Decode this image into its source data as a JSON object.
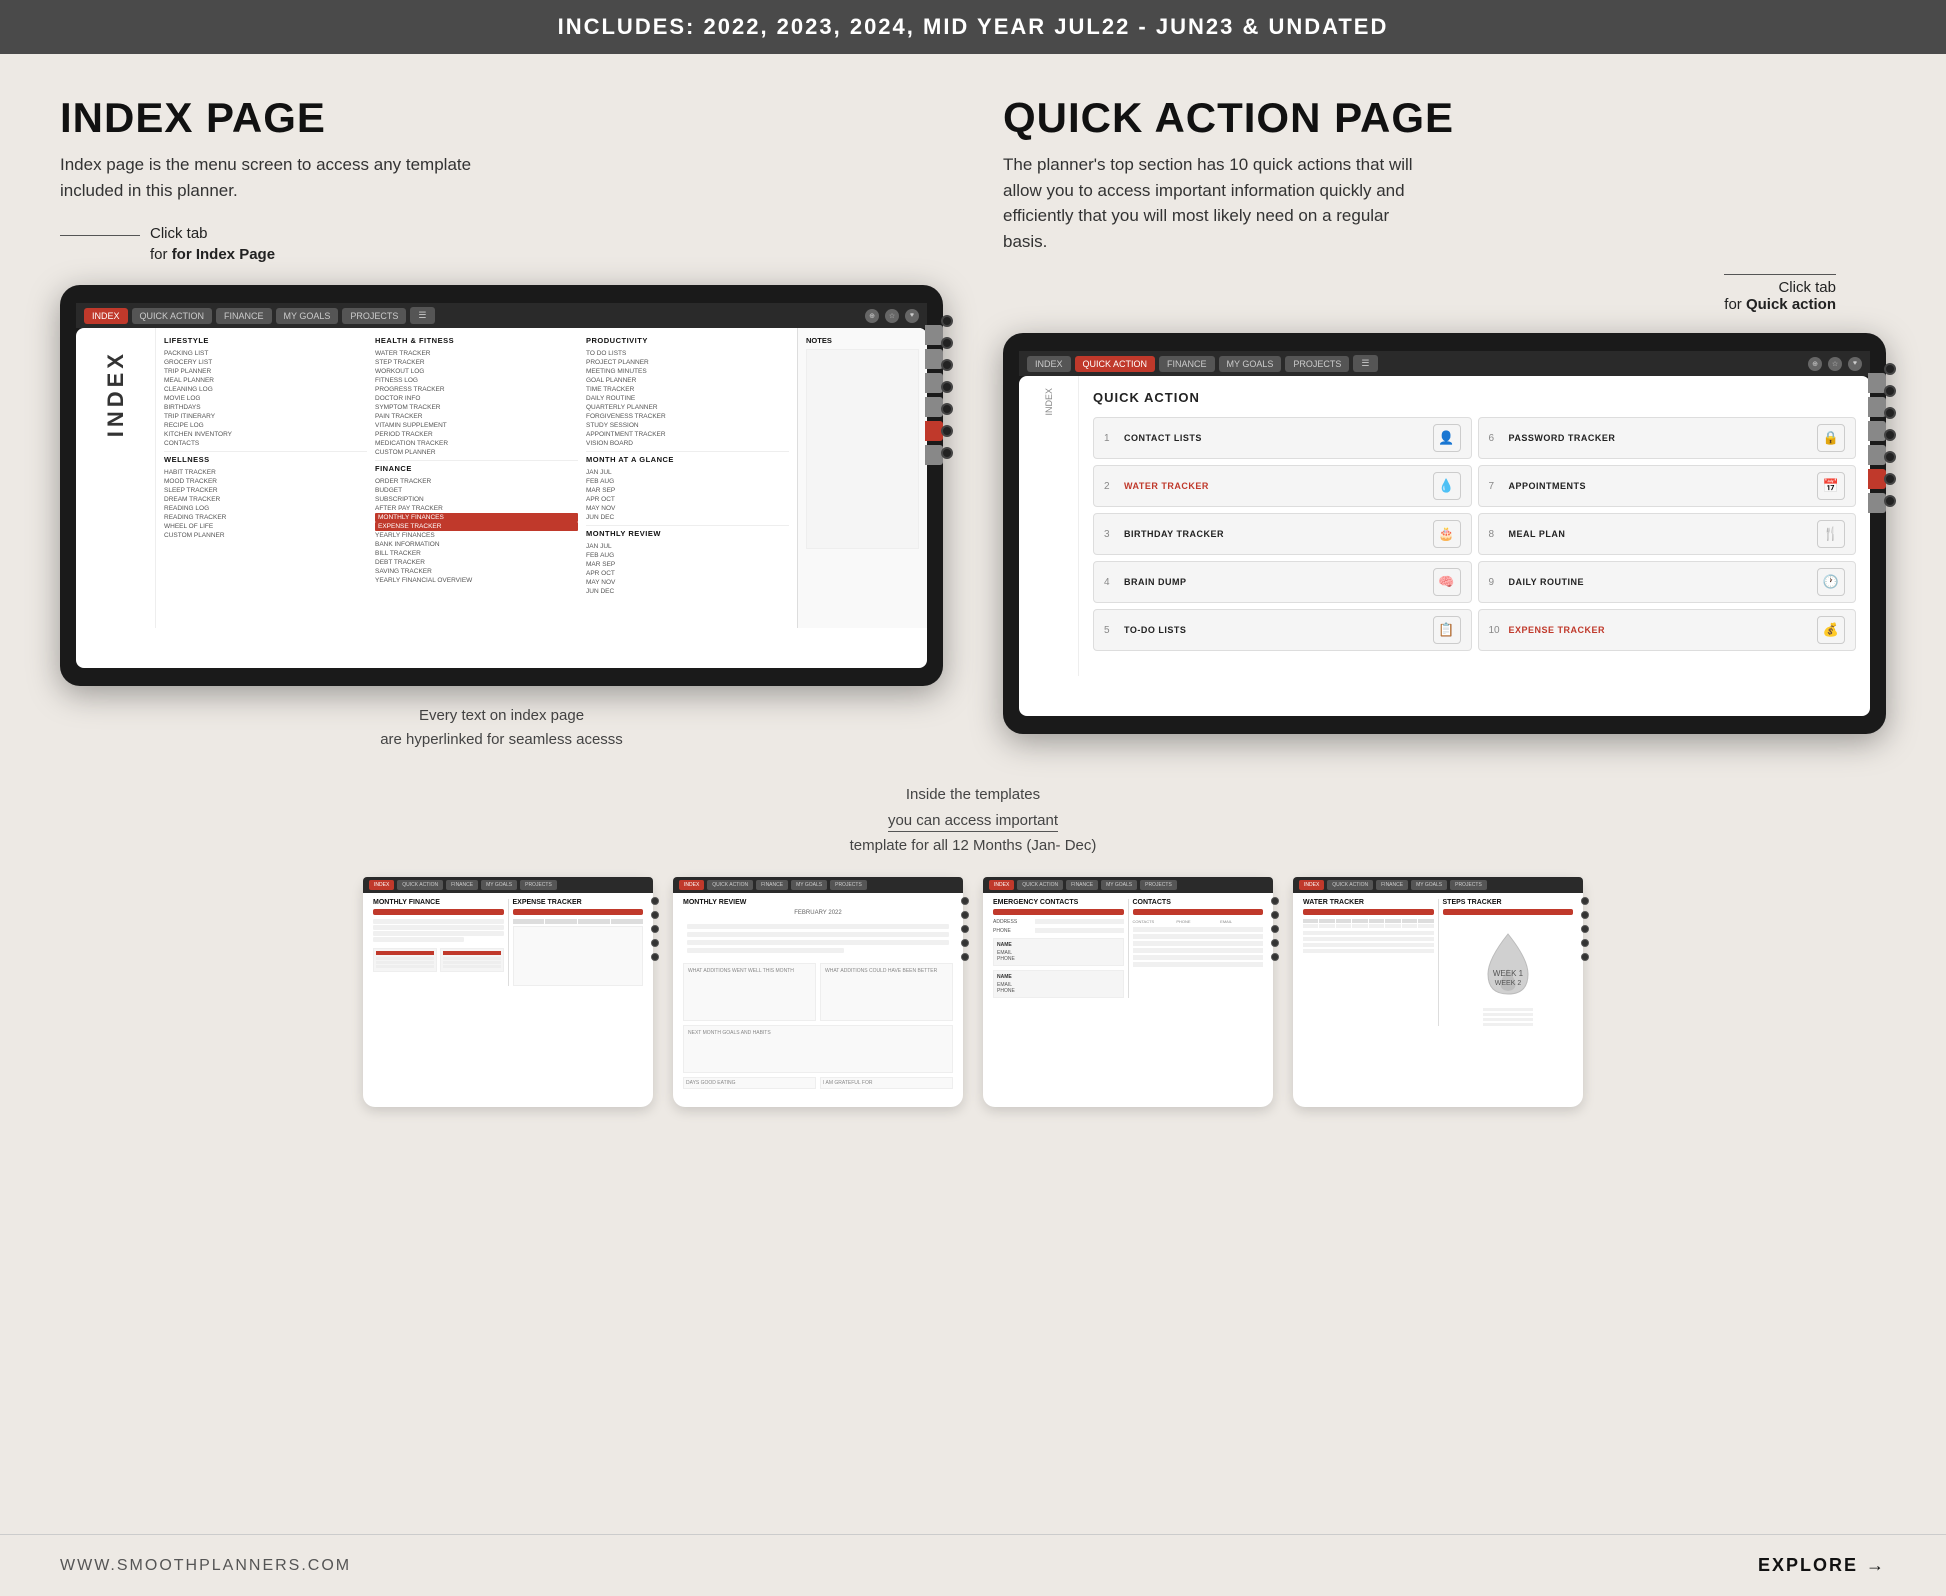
{
  "banner": {
    "text": "INCLUDES: 2022, 2023, 2024, MID YEAR JUL22 - JUN23 & UNDATED"
  },
  "left_section": {
    "title": "INDEX PAGE",
    "description": "Index page is the menu screen to access any template included in this planner.",
    "callout": {
      "line1": "Click tab",
      "line2": "for Index Page"
    },
    "tablet": {
      "nav_tabs": [
        "INDEX",
        "QUICK ACTION",
        "FINANCE",
        "MY GOALS",
        "PROJECTS"
      ],
      "active_tab": "INDEX",
      "index_heading": "INDEX",
      "lifestyle_items": [
        "LIFESTYLE",
        "PACKING LIST",
        "GROCERY LIST",
        "TRIP PLANNER",
        "MEAL PLANNER",
        "CLEANING LOG",
        "MOVIE LOG",
        "BIRTHDAYS",
        "TRIP ITINERARY",
        "RECIPE LOG",
        "KITCHEN INVENTORY",
        "CONTACTS"
      ],
      "wellness_items": [
        "WELLNESS",
        "HABIT TRACKER",
        "MOOD TRACKER",
        "SLEEP TRACKER",
        "DREAM TRACKER",
        "READING LOG",
        "READING TRACKER",
        "WHEEL OF LIFE",
        "CUSTOM PLANNER"
      ],
      "health_items": [
        "HEALTH & FITNESS",
        "WATER TRACKER",
        "STEP TRACKER",
        "WORKOUT LOG",
        "FITNESS LOG",
        "PROGRESS TRACKER",
        "DOCTOR INFO",
        "SYMPTOM TRACKER",
        "PAIN TRACKER",
        "VITAMIN SUPPLEMENT",
        "PERIOD TRACKER",
        "MEDICATION TRACKER",
        "CUSTOM PLANNER"
      ],
      "finance_items": [
        "FINANCE",
        "ORDER TRACKER",
        "BUDGET",
        "SUBSCRIPTION",
        "AFTER PAY TRACKER",
        "MONTHLY FINANCES",
        "EXPENSE TRACKER",
        "YEARLY FINANCES",
        "BANK INFORMATION",
        "BILL TRACKER",
        "DEBT TRACKER",
        "SAVING TRACKER",
        "YEARLY FINANCIAL OVERVIEW"
      ],
      "productivity_items": [
        "PRODUCTIVITY",
        "TO DO LISTS",
        "PROJECT PLANNER",
        "MEETING MINUTES",
        "GOAL PLANNER",
        "TIME TRACKER",
        "DAILY ROUTINE",
        "QUARTERLY PLANNER",
        "FORGIVENESS TRACKER",
        "STUDY SESSION",
        "APPOINTMENT TRACKER",
        "VISION BOARD"
      ],
      "month_glance": [
        "MONTH AT A GLANCE",
        "JAN JUL",
        "FEB AUG",
        "MAR SEP",
        "APR OCT",
        "MAY NOV",
        "JUN DEC"
      ],
      "monthly_review": [
        "MONTHLY REVIEW",
        "JAN JUL",
        "FEB AUG",
        "MAR SEP",
        "APR OCT",
        "MAY NOV",
        "JUN DEC"
      ]
    }
  },
  "right_section": {
    "title": "QUICK ACTION PAGE",
    "description": "The planner's top section has 10 quick actions that will allow you to access important information quickly and efficiently that you will most likely need on a regular basis.",
    "callout": {
      "line1": "Click tab",
      "line2": "for Quick action"
    },
    "tablet": {
      "nav_tabs": [
        "INDEX",
        "QUICK ACTION",
        "FINANCE",
        "MY GOALS",
        "PROJECTS"
      ],
      "active_tab": "QUICK ACTION",
      "qa_title": "QUICK ACTION",
      "items_left": [
        {
          "num": "1",
          "label": "CONTACT LISTS",
          "icon": "👤"
        },
        {
          "num": "2",
          "label": "WATER TRACKER",
          "icon": "💧"
        },
        {
          "num": "3",
          "label": "BIRTHDAY TRACKER",
          "icon": "🎂"
        },
        {
          "num": "4",
          "label": "BRAIN DUMP",
          "icon": "🧠"
        },
        {
          "num": "5",
          "label": "TO-DO LISTS",
          "icon": "📋"
        }
      ],
      "items_right": [
        {
          "num": "6",
          "label": "PASSWORD TRACKER",
          "icon": "🔒"
        },
        {
          "num": "7",
          "label": "APPOINTMENTS",
          "icon": "📅"
        },
        {
          "num": "8",
          "label": "MEAL PLAN",
          "icon": "🍴"
        },
        {
          "num": "9",
          "label": "DAILY ROUTINE",
          "icon": "🕐"
        },
        {
          "num": "10",
          "label": "EXPENSE TRACKER",
          "icon": "💰"
        }
      ]
    }
  },
  "middle_annotation": "Every text on index page\nare hyperlinked  for seamless acesss",
  "bottom_annotation_line1": "Inside the templates",
  "bottom_annotation_line2": "you can access important",
  "bottom_annotation_line3": "template for all 12 Months  (Jan- Dec)",
  "thumbnails": [
    {
      "title": "MONTHLY FINANCE",
      "subtitle": "EXPENSE TRACKER",
      "type": "finance"
    },
    {
      "title": "MONTHLY REVIEW",
      "subtitle": "",
      "type": "review"
    },
    {
      "title": "EMERGENCY CONTACTS",
      "subtitle": "CONTACTS",
      "type": "contacts"
    },
    {
      "title": "WATER TRACKER",
      "subtitle": "STEPS TRACKER",
      "type": "water"
    }
  ],
  "footer": {
    "url": "WWW.SMOOTHPLANNERS.COM",
    "explore_label": "EXPLORE",
    "arrow": "→"
  },
  "colors": {
    "accent": "#c0392b",
    "dark": "#1a1a1a",
    "banner_bg": "#4a4a4a",
    "body_bg": "#ede9e4"
  }
}
